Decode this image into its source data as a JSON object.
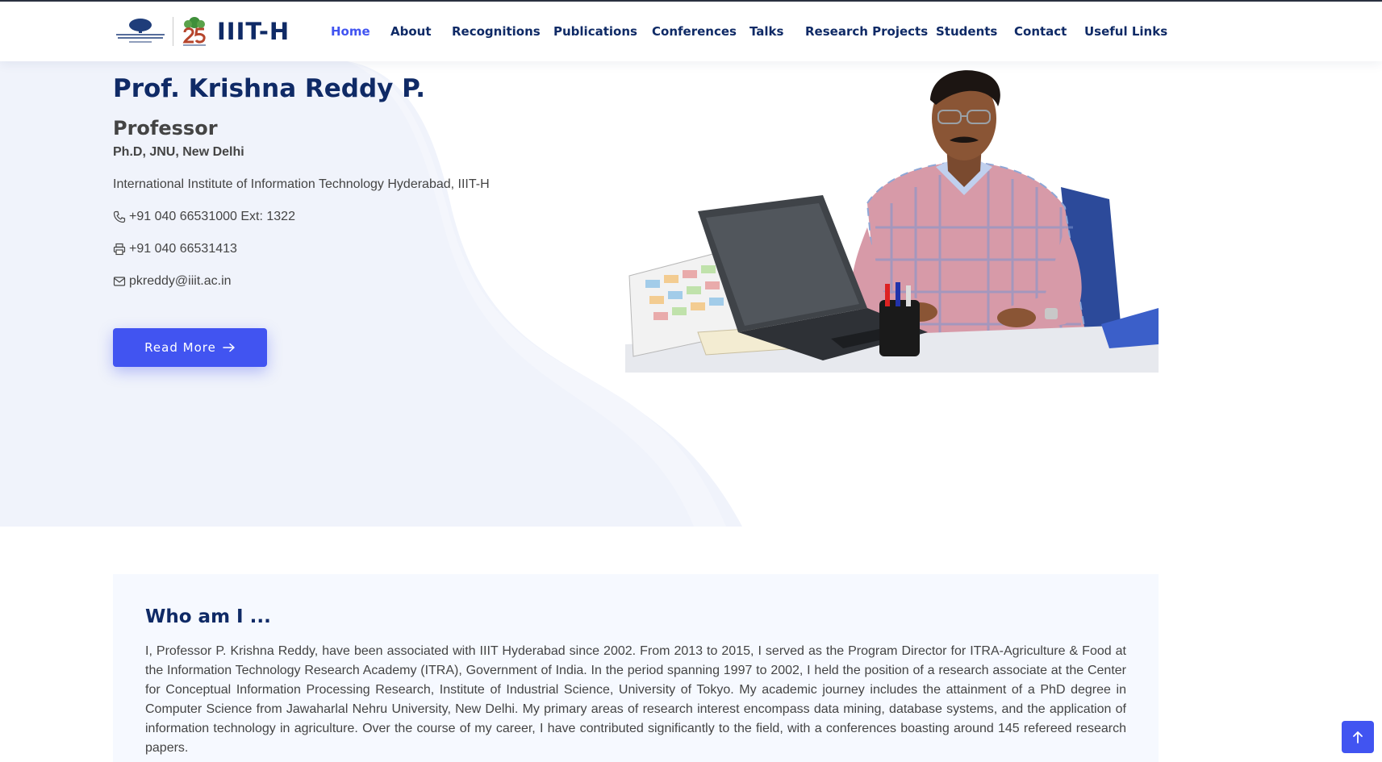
{
  "header": {
    "logo_text": "IIIT-H",
    "logo_emblem_alt": "International Institute of Information Technology",
    "logo_25_alt": "25 years"
  },
  "nav": {
    "items": [
      {
        "label": "Home",
        "active": true
      },
      {
        "label": "About"
      },
      {
        "label": "Recognitions"
      },
      {
        "label": "Publications"
      },
      {
        "label": "Conferences"
      },
      {
        "label": "Talks"
      },
      {
        "label": "Research Projects"
      },
      {
        "label": "Students"
      },
      {
        "label": "Contact"
      },
      {
        "label": "Useful Links"
      }
    ]
  },
  "hero": {
    "name": "Prof. Krishna Reddy P.",
    "title": "Professor",
    "degree": "Ph.D, JNU, New Delhi",
    "institute": "International Institute of Information Technology Hyderabad, IIIT-H",
    "phone": "+91 040 66531000 Ext: 1322",
    "fax": "+91 040 66531413",
    "email": "pkreddy@iiit.ac.in",
    "read_more_label": "Read More",
    "icons": {
      "phone": "phone-icon",
      "fax": "printer-icon",
      "email": "envelope-icon",
      "arrow": "arrow-right-icon"
    }
  },
  "about": {
    "heading": "Who am I ...",
    "text": "I, Professor P. Krishna Reddy, have been associated with IIIT Hyderabad since 2002. From 2013 to 2015, I served as the Program Director for ITRA-Agriculture & Food at the Information Technology Research Academy (ITRA), Government of India. In the period spanning 1997 to 2002, I held the position of a research associate at the Center for Conceptual Information Processing Research, Institute of Industrial Science, University of Tokyo. My academic journey includes the attainment of a PhD degree in Computer Science from Jawaharlal Nehru University, New Delhi. My primary areas of research interest encompass data mining, database systems, and the application of information technology in agriculture. Over the course of my career, I have contributed significantly to the field, with a conferences boasting around 145 refereed research papers."
  },
  "colors": {
    "primary": "#4154f1",
    "heading": "#0f2a66",
    "text": "#444444",
    "hero_bg": "#f0f3fb",
    "about_bg": "#f6f9ff"
  }
}
